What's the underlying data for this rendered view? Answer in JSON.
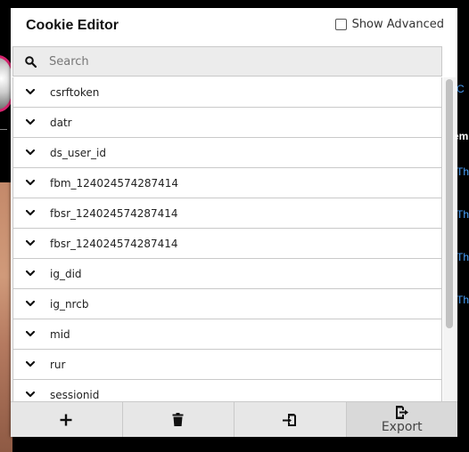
{
  "background": {
    "right_texts": [
      "C",
      "em",
      "Th",
      "Th",
      "Th",
      "Th"
    ]
  },
  "popup": {
    "title": "Cookie Editor",
    "show_advanced_label": "Show Advanced",
    "show_advanced_checked": false,
    "search": {
      "placeholder": "Search",
      "value": ""
    },
    "cookies": [
      "csrftoken",
      "datr",
      "ds_user_id",
      "fbm_124024574287414",
      "fbsr_124024574287414",
      "fbsr_124024574287414",
      "ig_did",
      "ig_nrcb",
      "mid",
      "rur",
      "sessionid"
    ],
    "footer": {
      "add_icon": "plus-icon",
      "delete_icon": "trash-icon",
      "import_icon": "import-icon",
      "export_icon": "export-icon",
      "export_label": "Export"
    }
  }
}
